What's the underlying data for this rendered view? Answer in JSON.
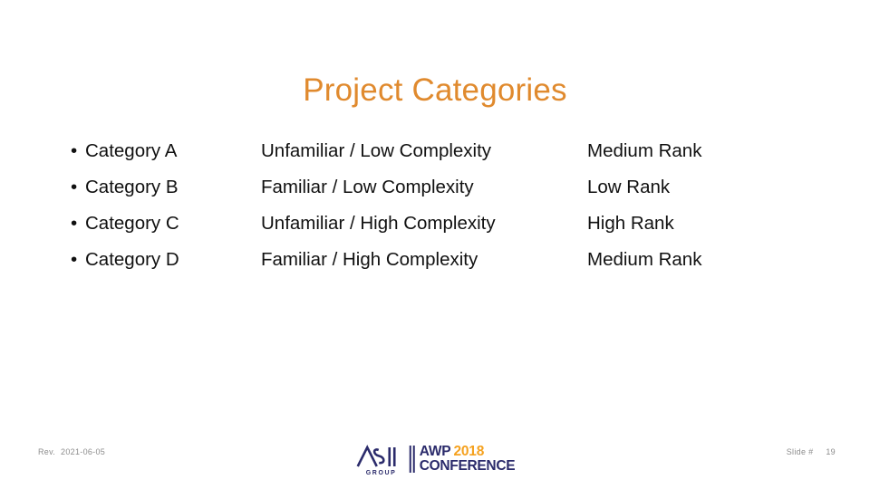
{
  "slide": {
    "title": "Project Categories",
    "title_color": "#E08A2E",
    "background_color": "#FFFFFF"
  },
  "content": {
    "categories": [
      {
        "bullet": "•",
        "label": "Category A"
      },
      {
        "bullet": "•",
        "label": "Category B"
      },
      {
        "bullet": "•",
        "label": "Category C"
      },
      {
        "bullet": "•",
        "label": "Category D"
      }
    ],
    "descriptions": [
      "Unfamiliar / Low Complexity",
      "Familiar / Low Complexity",
      "Unfamiliar / High Complexity",
      "Familiar / High Complexity"
    ],
    "ranks": [
      "Medium Rank",
      "Low Rank",
      "High Rank",
      "Medium Rank"
    ]
  },
  "footer": {
    "revision_label": "Rev.",
    "revision_date": "2021-06-05",
    "slide_number_label": "Slide #",
    "slide_number": "19",
    "text_color": "#8C8C8C",
    "logo": {
      "mark_text": "ASI",
      "mark_subtext": "GROUP",
      "line1_primary": "AWP",
      "line1_year": "2018",
      "line2": "CONFERENCE",
      "navy": "#2B2B6B",
      "orange": "#F5A11E"
    }
  }
}
